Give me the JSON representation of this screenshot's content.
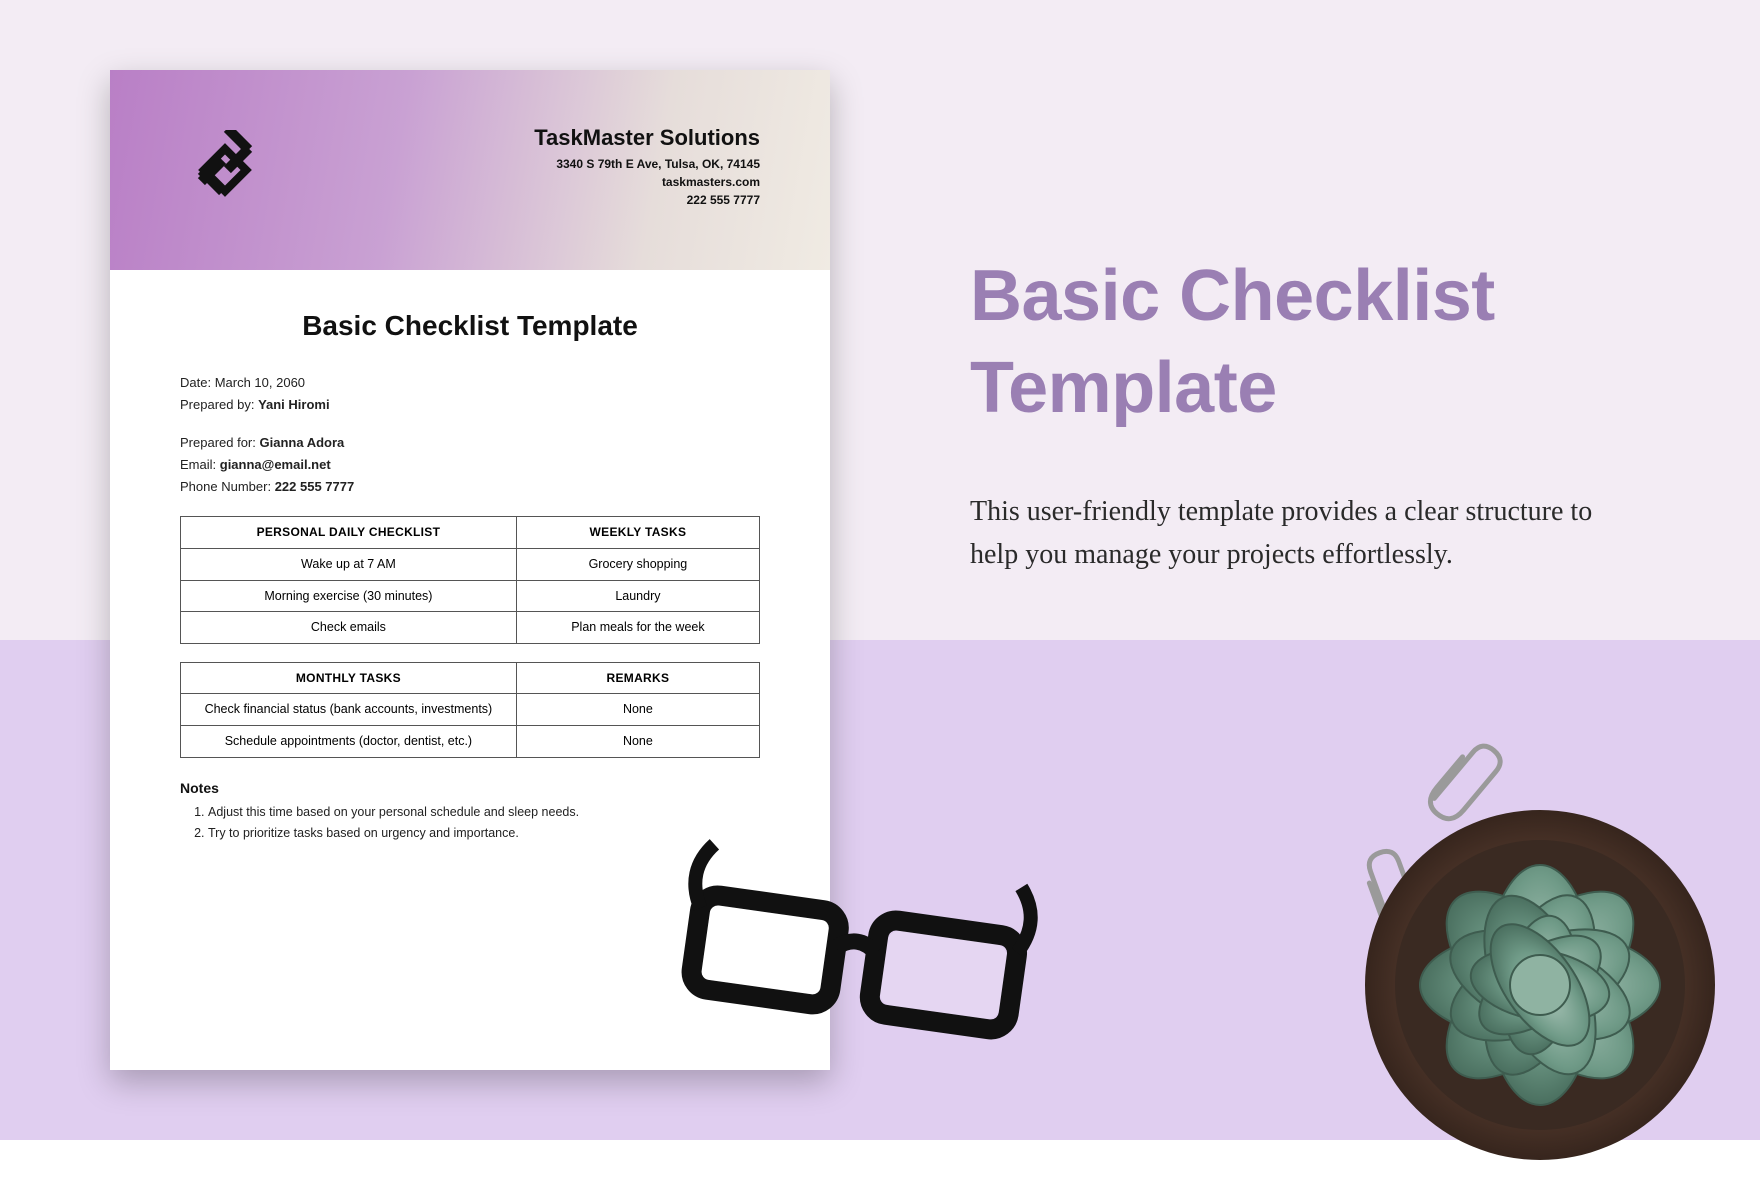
{
  "company": {
    "name": "TaskMaster Solutions",
    "address": "3340 S 79th E Ave, Tulsa, OK, 74145",
    "website": "taskmasters.com",
    "phone": "222 555 7777"
  },
  "document": {
    "title": "Basic Checklist Template",
    "date_label": "Date:",
    "date": "March 10, 2060",
    "prepared_by_label": "Prepared by:",
    "prepared_by": "Yani Hiromi",
    "prepared_for_label": "Prepared for:",
    "prepared_for": "Gianna Adora",
    "email_label": "Email:",
    "email": "gianna@email.net",
    "phone_label": "Phone Number:",
    "phone": "222 555 7777"
  },
  "table1": {
    "headers": [
      "PERSONAL DAILY CHECKLIST",
      "WEEKLY TASKS"
    ],
    "rows": [
      [
        "Wake up at 7 AM",
        "Grocery shopping"
      ],
      [
        "Morning exercise (30 minutes)",
        "Laundry"
      ],
      [
        "Check emails",
        "Plan meals for the week"
      ]
    ]
  },
  "table2": {
    "headers": [
      "MONTHLY TASKS",
      "REMARKS"
    ],
    "rows": [
      [
        "Check financial status (bank accounts, investments)",
        "None"
      ],
      [
        "Schedule appointments (doctor, dentist, etc.)",
        "None"
      ]
    ]
  },
  "notes": {
    "heading": "Notes",
    "items": [
      "Adjust this time based on your personal schedule and sleep needs.",
      "Try to prioritize tasks based on urgency and importance."
    ]
  },
  "promo": {
    "headline": "Basic Checklist Template",
    "subcopy": "This user-friendly template provides a clear structure to help you manage your projects effortlessly."
  }
}
